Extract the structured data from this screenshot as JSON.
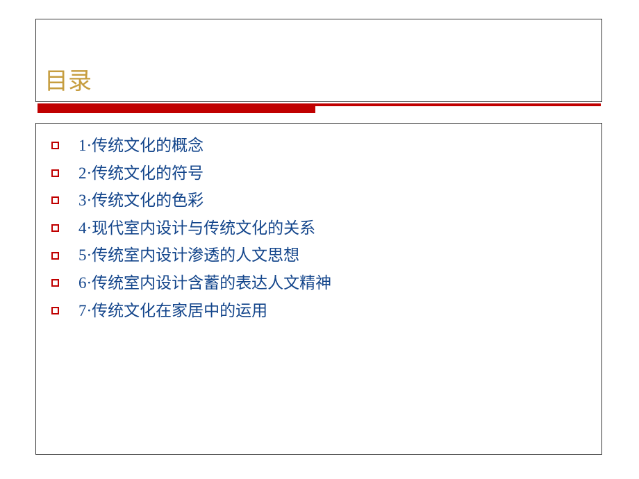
{
  "title": "目录",
  "items": [
    "1·传统文化的概念",
    "2·传统文化的符号",
    "3·传统文化的色彩",
    "4·现代室内设计与传统文化的关系",
    "5·传统室内设计渗透的人文思想",
    "6·传统室内设计含蓄的表达人文精神",
    "7·传统文化在家居中的运用"
  ]
}
